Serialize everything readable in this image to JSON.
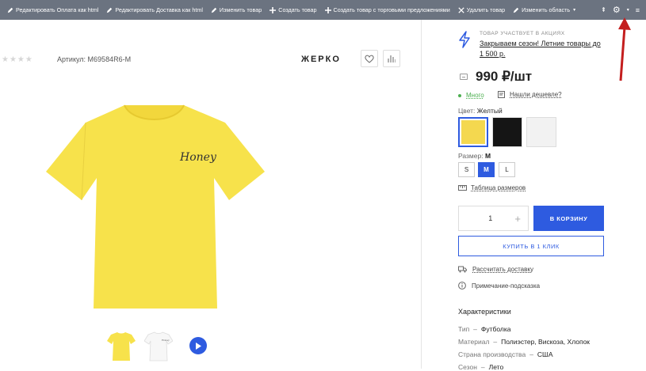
{
  "adminbar": {
    "items": [
      {
        "label": "Редактировать Оплата как html"
      },
      {
        "label": "Редактировать Доставка как html"
      },
      {
        "label": "Изменить товар"
      },
      {
        "label": "Создать товар"
      },
      {
        "label": "Создать товар с торговыми предложениями"
      },
      {
        "label": "Удалить товар"
      },
      {
        "label": "Изменить область"
      }
    ]
  },
  "product": {
    "article": "Артикул: M69584R6-M",
    "brand": "ЖЕРКО",
    "print_text": "Honey",
    "colors": {
      "yellow": "#f7e24b",
      "accent": "#2e5be0"
    }
  },
  "promo": {
    "label": "ТОВАР УЧАСТВУЕТ В АКЦИЯХ",
    "text": "Закрываем сезон! Летние товары до 1 500 р."
  },
  "price": "990 ₽/шт",
  "stock": {
    "status": "Много",
    "cheaper": "Нашли дешевле?"
  },
  "color": {
    "label": "Цвет:",
    "value": "Желтый"
  },
  "size": {
    "label": "Размер:",
    "value": "M",
    "options": [
      "S",
      "M",
      "L"
    ]
  },
  "size_table": "Таблица размеров",
  "quantity": "1",
  "buttons": {
    "cart": "В КОРЗИНУ",
    "one_click": "КУПИТЬ В 1 КЛИК"
  },
  "delivery": "Рассчитать доставку",
  "hint": "Примечание-подсказка",
  "characteristics": {
    "title": "Характеристики",
    "rows": [
      {
        "key": "Тип",
        "value": "Футболка"
      },
      {
        "key": "Материал",
        "value": "Полиэстер, Вискоза, Хлопок"
      },
      {
        "key": "Страна производства",
        "value": "США"
      },
      {
        "key": "Сезон",
        "value": "Лето"
      }
    ]
  }
}
